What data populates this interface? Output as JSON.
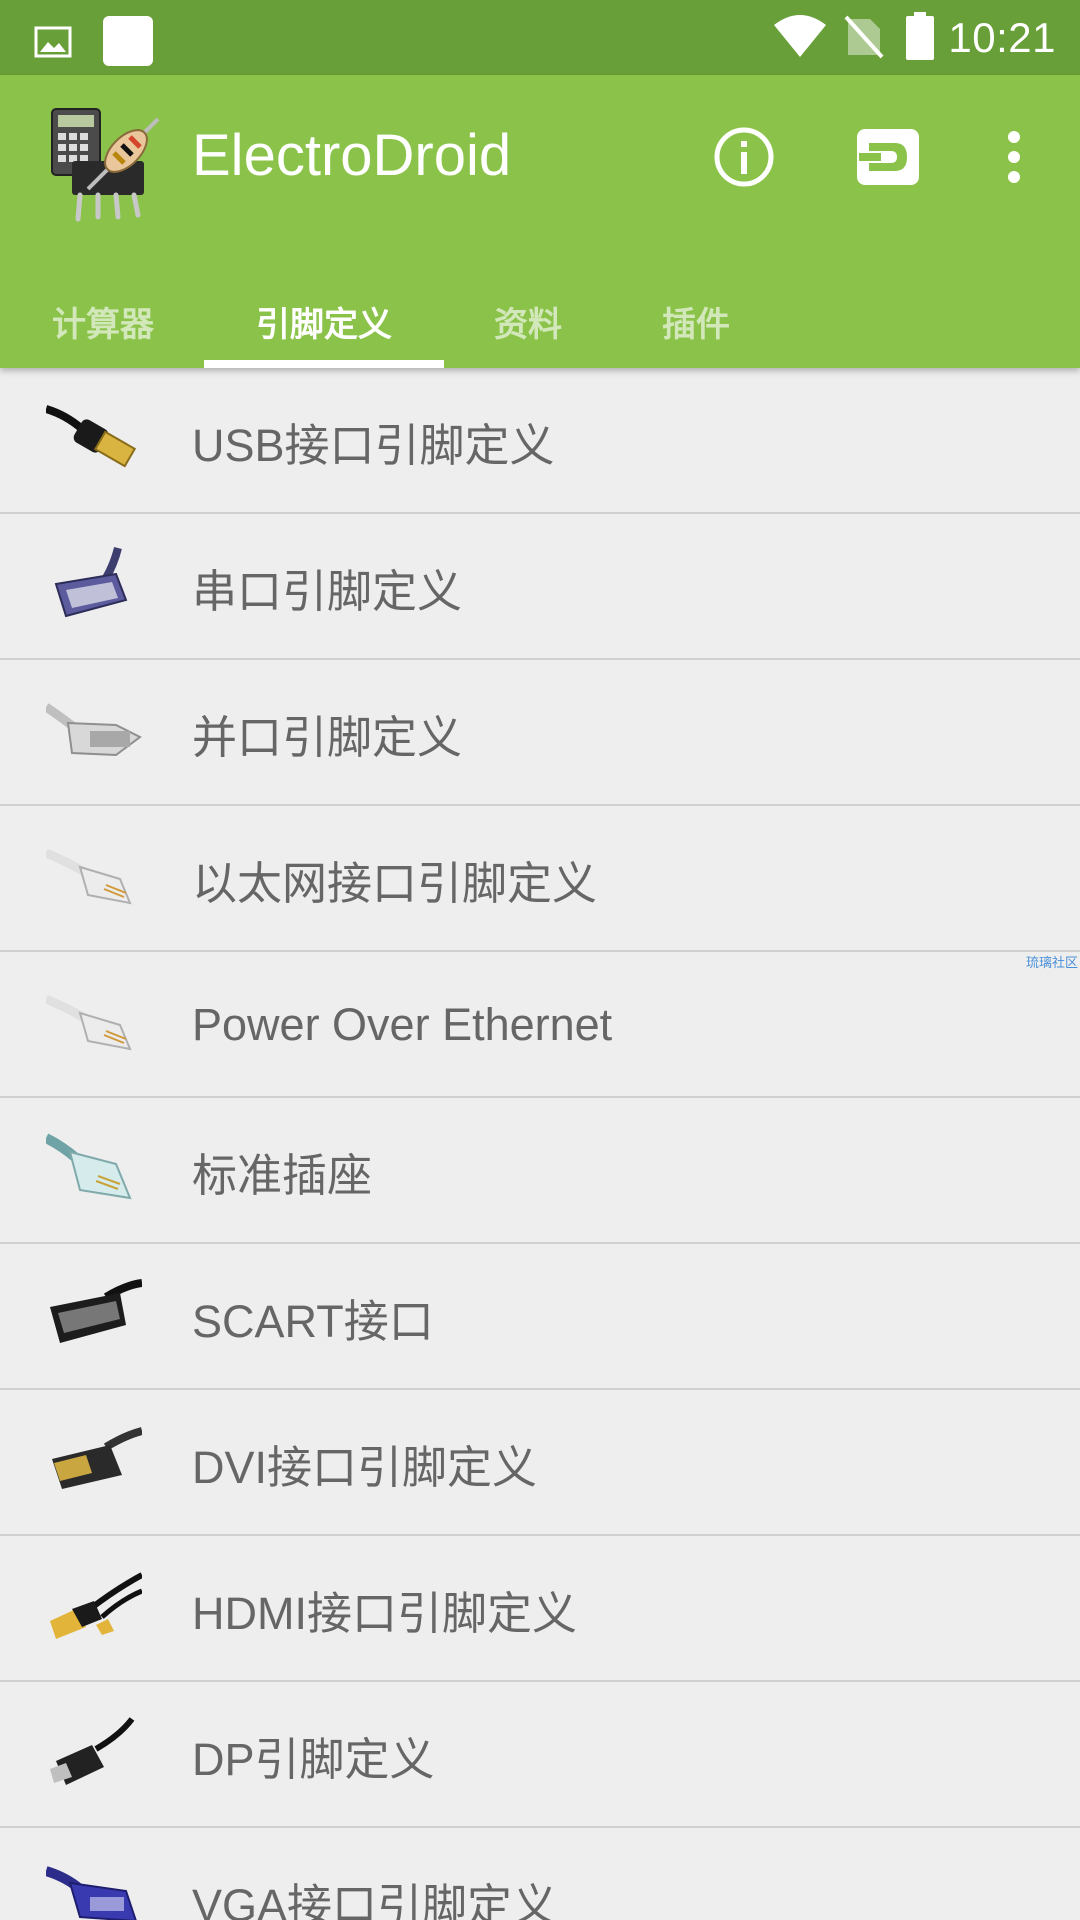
{
  "status_bar": {
    "time": "10:21",
    "icons": [
      "image-icon",
      "notification-square-icon",
      "wifi-icon",
      "no-sim-icon",
      "battery-icon"
    ]
  },
  "app_bar": {
    "title": "ElectroDroid",
    "actions": [
      "info-icon",
      "plugin-icon",
      "more-vert-icon"
    ],
    "background": "#8bc34a",
    "status_color": "#689f38"
  },
  "tabs": [
    {
      "label": "计算器",
      "active": false
    },
    {
      "label": "引脚定义",
      "active": true
    },
    {
      "label": "资料",
      "active": false
    },
    {
      "label": "插件",
      "active": false
    }
  ],
  "list": {
    "items": [
      {
        "label": "USB接口引脚定义",
        "icon": "usb-connector-icon"
      },
      {
        "label": "串口引脚定义",
        "icon": "serial-connector-icon"
      },
      {
        "label": "并口引脚定义",
        "icon": "parallel-connector-icon"
      },
      {
        "label": "以太网接口引脚定义",
        "icon": "ethernet-connector-icon"
      },
      {
        "label": "Power Over Ethernet",
        "icon": "poe-connector-icon"
      },
      {
        "label": "标准插座",
        "icon": "phone-jack-icon"
      },
      {
        "label": "SCART接口",
        "icon": "scart-connector-icon"
      },
      {
        "label": "DVI接口引脚定义",
        "icon": "dvi-connector-icon"
      },
      {
        "label": "HDMI接口引脚定义",
        "icon": "hdmi-connector-icon"
      },
      {
        "label": "DP引脚定义",
        "icon": "displayport-connector-icon"
      },
      {
        "label": "VGA接口引脚定义",
        "icon": "vga-connector-icon"
      }
    ]
  },
  "watermark": "琉璃社区"
}
